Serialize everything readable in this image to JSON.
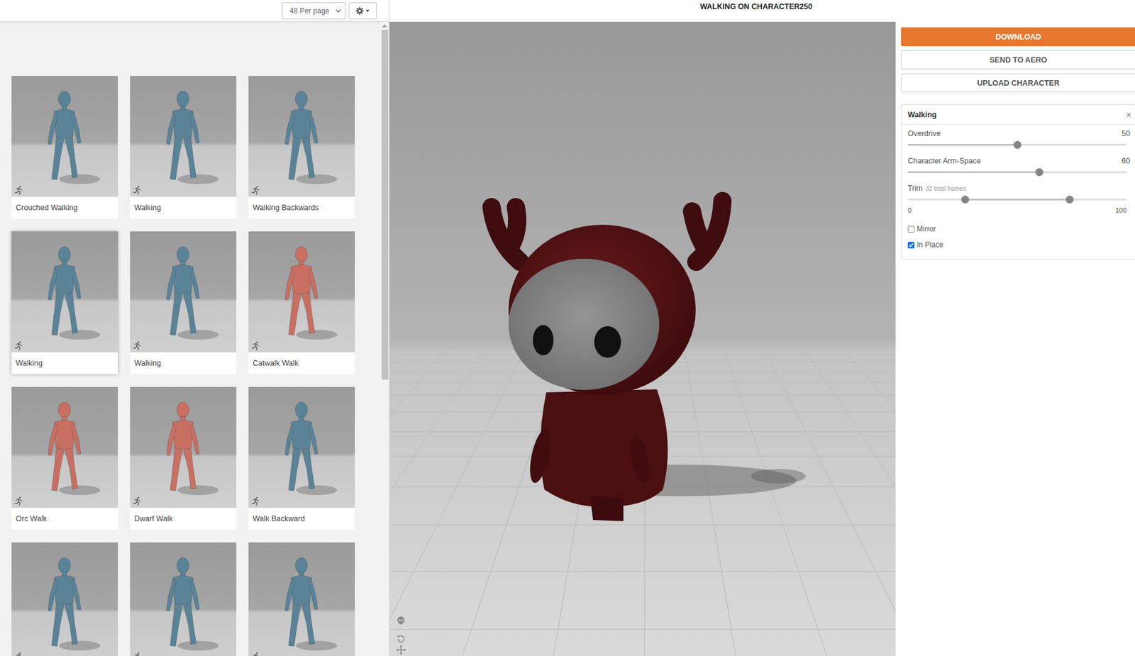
{
  "toolbar": {
    "per_page": "48 Per page"
  },
  "animations": [
    {
      "label": "Crouched Walking",
      "color": "#5b8397",
      "selected": false
    },
    {
      "label": "Walking",
      "color": "#5b8397",
      "selected": false
    },
    {
      "label": "Walking Backwards",
      "color": "#5b8397",
      "selected": false
    },
    {
      "label": "Walking",
      "color": "#5b8397",
      "selected": true
    },
    {
      "label": "Walking",
      "color": "#5b8397",
      "selected": false
    },
    {
      "label": "Catwalk Walk",
      "color": "#c96f62",
      "selected": false
    },
    {
      "label": "Orc Walk",
      "color": "#c96f62",
      "selected": false
    },
    {
      "label": "Dwarf Walk",
      "color": "#c96f62",
      "selected": false
    },
    {
      "label": "Walk Backward",
      "color": "#5b8397",
      "selected": false
    },
    {
      "color": "#5b8397",
      "selected": false
    },
    {
      "color": "#5b8397",
      "selected": false
    },
    {
      "color": "#5b8397",
      "selected": false
    }
  ],
  "header": {
    "title": "WALKING ON CHARACTER250"
  },
  "actions": [
    {
      "label": "DOWNLOAD",
      "primary": true
    },
    {
      "label": "SEND TO AERO",
      "primary": false
    },
    {
      "label": "UPLOAD CHARACTER",
      "primary": false
    }
  ],
  "settings": {
    "title": "Walking",
    "close": "×",
    "controls": [
      {
        "kind": "slider",
        "label": "Overdrive",
        "reading": "50",
        "level": 0.5
      },
      {
        "kind": "slider",
        "label": "Character Arm-Space",
        "reading": "60",
        "level": 0.6
      },
      {
        "kind": "range",
        "label": "Trim",
        "note": "32 total frames",
        "levels": [
          0.26,
          0.74
        ],
        "min": "0",
        "max": "100"
      },
      {
        "kind": "checkbox",
        "label": "Mirror",
        "checked": false
      },
      {
        "kind": "checkbox",
        "label": "In Place",
        "checked": true
      }
    ]
  }
}
